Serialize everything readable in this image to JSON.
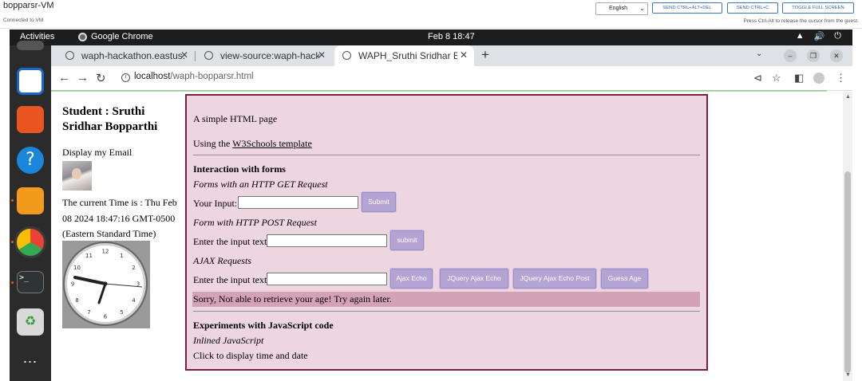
{
  "vm": {
    "title": "bopparsr-VM",
    "status": "Connected to VM",
    "language": "English",
    "buttons": [
      "SEND CTRL+ALT+DEL",
      "SEND CTRL+C",
      "TOGGLE FULL SCREEN"
    ],
    "hint": "Press Ctrl-Alt to release the cursor from the guest."
  },
  "desktop": {
    "activities": "Activities",
    "app": "Google Chrome",
    "clock": "Feb 8  18:47"
  },
  "browser": {
    "tabs": [
      {
        "label": "waph-hackathon.eastus.",
        "active": false
      },
      {
        "label": "view-source:waph-hacka",
        "active": false
      },
      {
        "label": "WAPH_Sruthi Sridhar Bo",
        "active": true
      }
    ],
    "url_host": "localhost",
    "url_path": "/waph-bopparsr.html"
  },
  "page": {
    "student": "Student : Sruthi Sridhar Bopparthi",
    "email": "Display my Email",
    "time": "The current Time is : Thu Feb 08 2024 18:47:16 GMT-0500 (Eastern Standard Time)",
    "clock_numbers": [
      "12",
      "1",
      "2",
      "3",
      "4",
      "5",
      "6",
      "7",
      "8",
      "9",
      "10",
      "11"
    ],
    "intro": "A simple HTML page",
    "using_prefix": "Using the ",
    "using_link": "W3Schools template",
    "forms_heading": "Interaction with forms",
    "get_heading": "Forms with an HTTP GET Request",
    "get_label": "Your Input:",
    "get_submit": "Submit",
    "post_heading": "Form with HTTP POST Request",
    "post_label": "Enter the input text",
    "post_submit": "submit",
    "ajax_heading": "AJAX Requests",
    "ajax_label": "Enter the input text",
    "ajax_buttons": [
      "Ajax Echo",
      "JQuery Ajax Echo",
      "JQuery Ajax Echo Post",
      "Guess Age"
    ],
    "error": "Sorry, Not able to retrieve your age! Try again later.",
    "js_heading": "Experiments with JavaScript code",
    "js_inline": "Inlined JavaScript",
    "js_click": "Click to display time and date"
  }
}
